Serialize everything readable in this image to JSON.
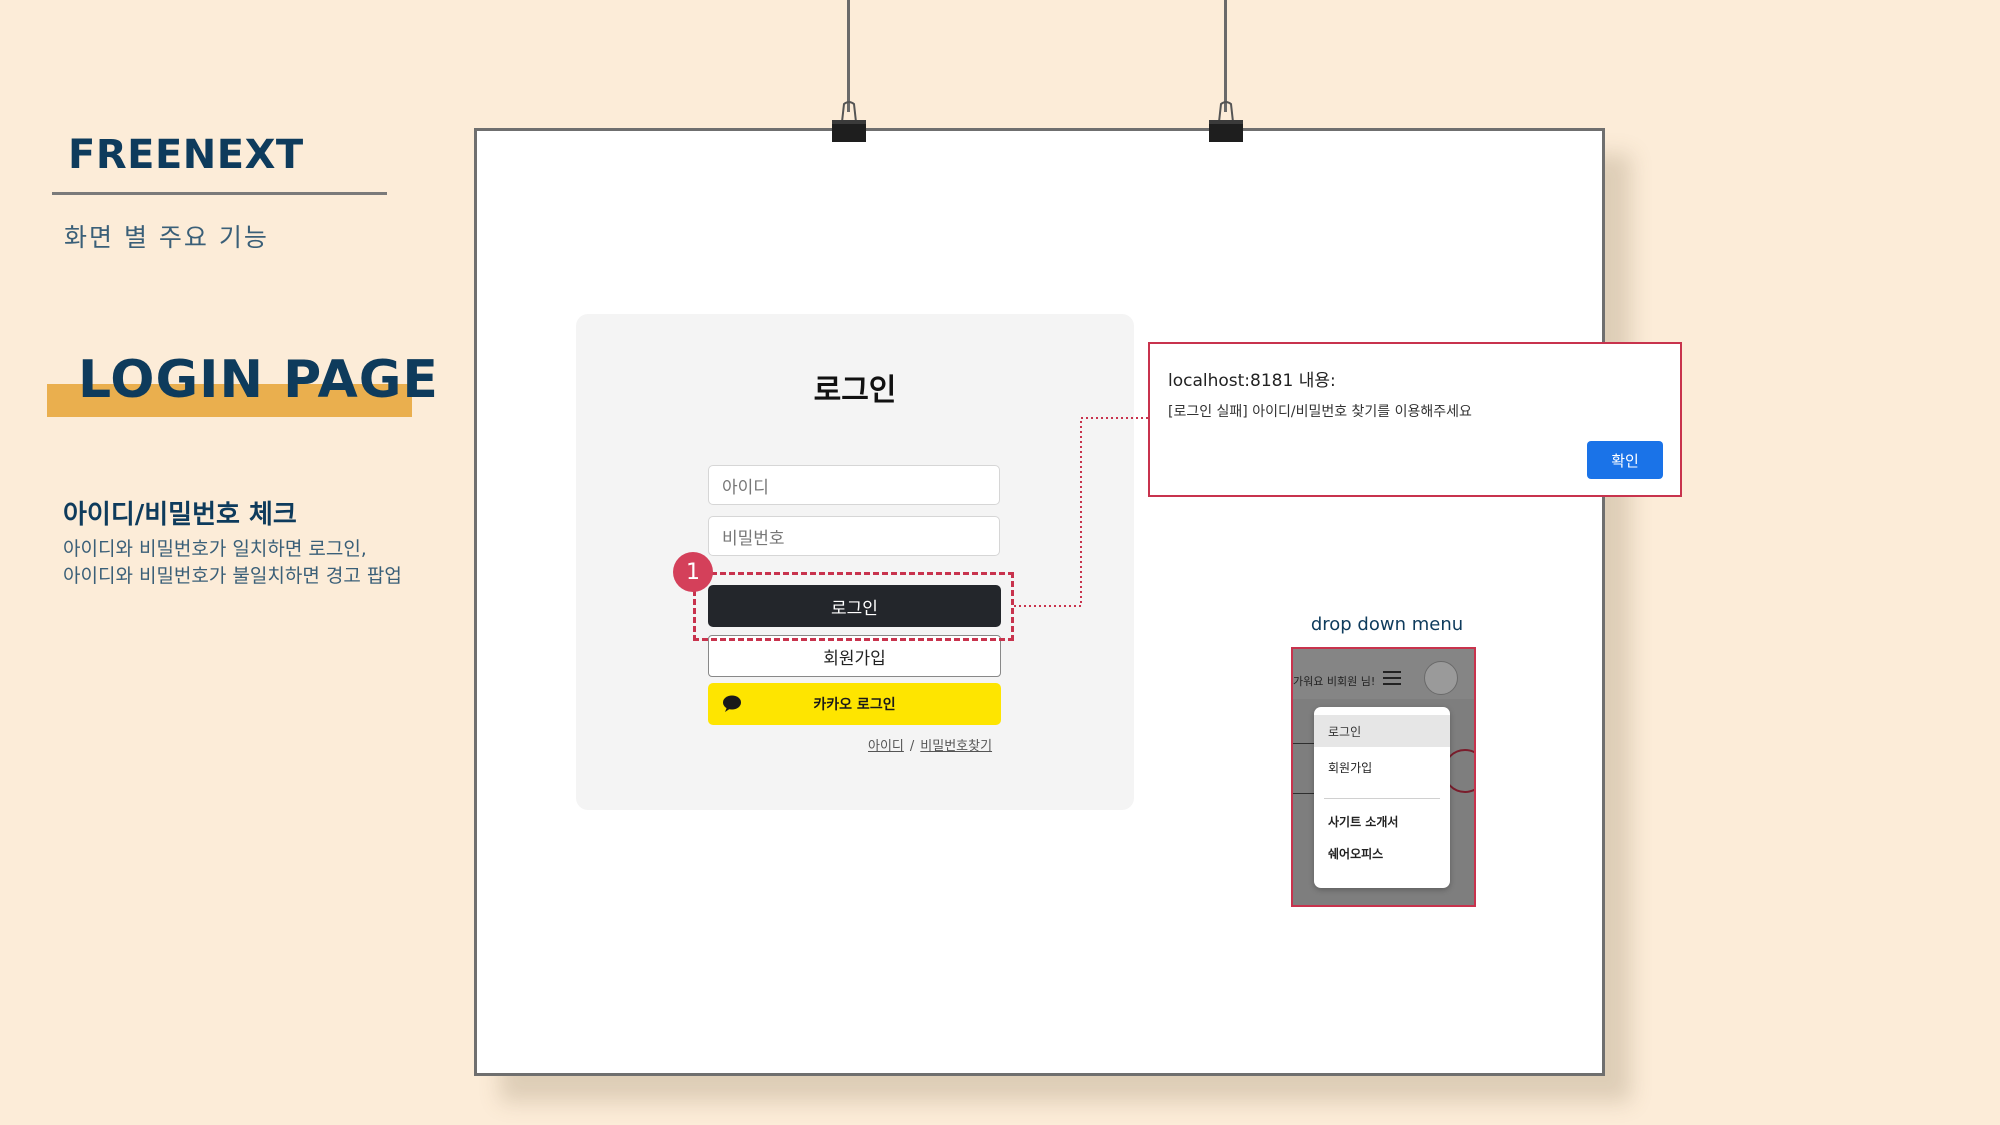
{
  "left_panel": {
    "brand": "FREENEXT",
    "subtitle": "화면 별 주요 기능",
    "page_title": "LOGIN PAGE",
    "feature_title": "아이디/비밀번호 체크",
    "feature_desc_line1": "아이디와 비밀번호가 일치하면 로그인,",
    "feature_desc_line2": "아이디와 비밀번호가 불일치하면 경고 팝업"
  },
  "login": {
    "title": "로그인",
    "id_placeholder": "아이디",
    "pw_placeholder": "비밀번호",
    "login_button": "로그인",
    "join_button": "회원가입",
    "kakao_button": "카카오 로그인",
    "find_id": "아이디",
    "find_sep": "/",
    "find_pw": "비밀번호찾기"
  },
  "annotation": {
    "badge_number": "1",
    "accent_color": "#c8334d"
  },
  "alert": {
    "title": "localhost:8181 내용:",
    "message": "[로그인 실패] 아이디/비밀번호 찾기를 이용해주세요",
    "ok_button": "확인"
  },
  "dropdown": {
    "caption": "drop down menu",
    "greeting": "가워요 비회원 님!",
    "items": [
      "로그인",
      "회원가입",
      "사기트 소개서",
      "쉐어오피스"
    ]
  },
  "colors": {
    "background": "#fcecd8",
    "brand_navy": "#0e3b5c",
    "highlight": "#eaaf4e",
    "kakao_yellow": "#fee500",
    "login_dark": "#23262b",
    "alert_blue": "#1a73e8"
  }
}
